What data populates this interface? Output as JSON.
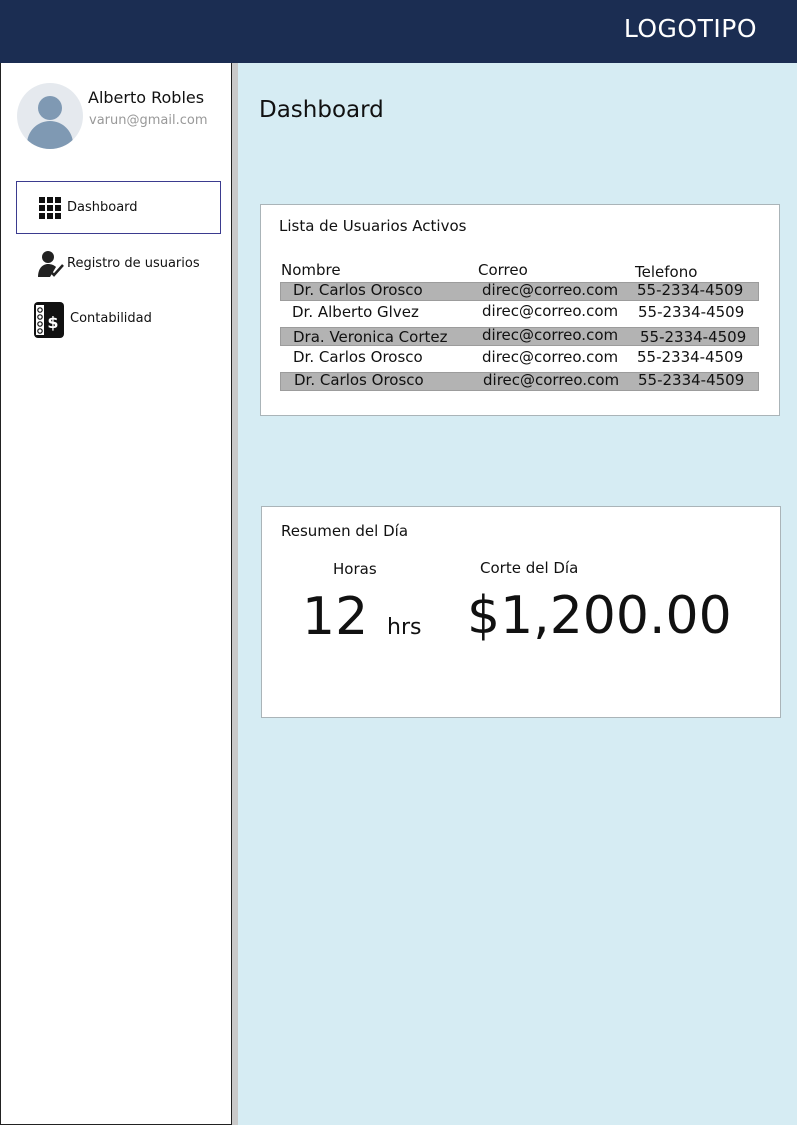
{
  "header": {
    "logo": "LOGOTIPO"
  },
  "user": {
    "name": "Alberto Robles",
    "email": "varun@gmail.com"
  },
  "sidebar": {
    "items": [
      {
        "label": "Dashboard",
        "icon": "grid-icon",
        "active": true
      },
      {
        "label": "Registro de usuarios",
        "icon": "user-check-icon",
        "active": false
      },
      {
        "label": "Contabilidad",
        "icon": "accounting-book-icon",
        "active": false
      }
    ]
  },
  "main": {
    "title": "Dashboard"
  },
  "users_card": {
    "title": "Lista de Usuarios Activos",
    "columns": [
      "Nombre",
      "Correo",
      "Telefono"
    ],
    "rows": [
      {
        "nombre": "Dr. Carlos Orosco",
        "correo": "direc@correo.com",
        "telefono": "55-2334-4509",
        "shaded": true
      },
      {
        "nombre": "Dr. Alberto Glvez",
        "correo": "direc@correo.com",
        "telefono": "55-2334-4509",
        "shaded": false
      },
      {
        "nombre": "Dra. Veronica Cortez",
        "correo": "direc@correo.com",
        "telefono": "55-2334-4509",
        "shaded": true
      },
      {
        "nombre": "Dr. Carlos Orosco",
        "correo": "direc@correo.com",
        "telefono": "55-2334-4509",
        "shaded": false
      },
      {
        "nombre": "Dr. Carlos Orosco",
        "correo": "direc@correo.com",
        "telefono": "55-2334-4509",
        "shaded": true
      }
    ]
  },
  "summary_card": {
    "title": "Resumen del Día",
    "hours_label": "Horas",
    "hours_value": "12",
    "hours_unit": "hrs",
    "cut_label": "Corte del Día",
    "cut_value": "$1,200.00"
  },
  "colors": {
    "header_bg": "#1b2d52",
    "main_bg": "#d6ecf3",
    "row_shade": "#b3b3b3",
    "active_border": "#3b3b8f",
    "avatar_fill": "#7f99b3"
  }
}
